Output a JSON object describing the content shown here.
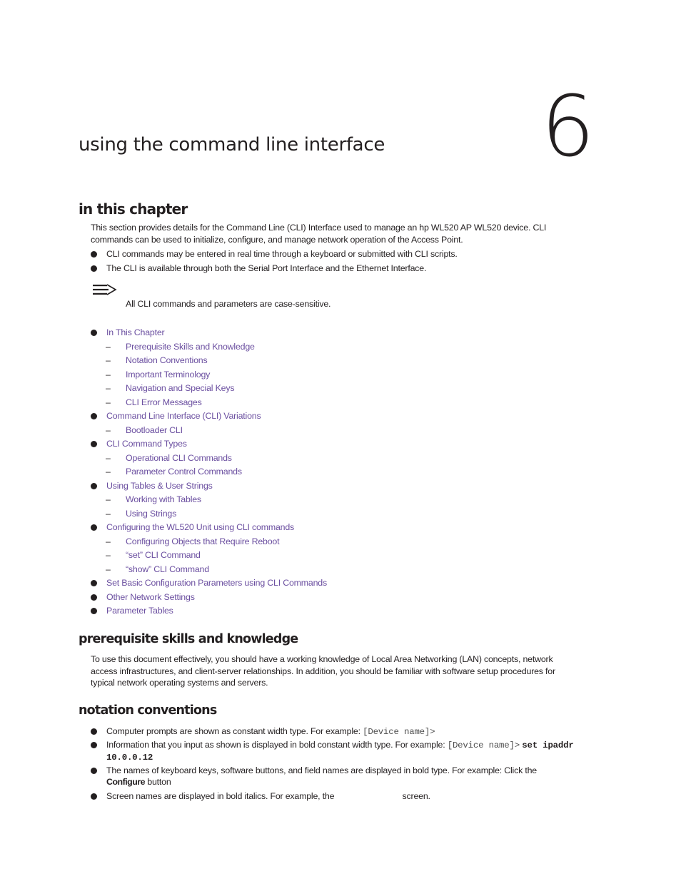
{
  "chapter": {
    "number": "6",
    "title": "using the command line interface"
  },
  "in_this_chapter": {
    "heading": "in this chapter",
    "intro": "This section provides details for the Command Line (CLI) Interface used to manage an hp WL520 AP WL520 device. CLI commands can be used to initialize, configure, and manage network operation of the Access Point.",
    "bullets": [
      "CLI commands may be entered in real time through a keyboard or submitted with CLI scripts.",
      "The CLI is available through both the Serial Port Interface and the Ethernet Interface."
    ],
    "note": {
      "icon": "note-arrow-icon",
      "text": "All CLI commands and parameters are case-sensitive."
    },
    "toc": [
      {
        "label": "In This Chapter",
        "children": [
          "Prerequisite Skills and Knowledge",
          "Notation Conventions",
          "Important Terminology",
          "Navigation and Special Keys",
          "CLI Error Messages"
        ]
      },
      {
        "label": "Command Line Interface (CLI) Variations",
        "children": [
          "Bootloader CLI"
        ]
      },
      {
        "label": "CLI Command Types",
        "children": [
          "Operational CLI Commands",
          "Parameter Control Commands"
        ]
      },
      {
        "label": "Using Tables & User Strings",
        "children": [
          "Working with Tables",
          "Using Strings"
        ]
      },
      {
        "label": "Configuring the WL520 Unit using CLI commands",
        "children": [
          "Configuring Objects that Require Reboot",
          "“set” CLI Command",
          "“show” CLI Command"
        ]
      },
      {
        "label": "Set Basic Configuration Parameters using CLI Commands",
        "children": []
      },
      {
        "label": "Other Network Settings",
        "children": []
      },
      {
        "label": "Parameter Tables",
        "children": []
      }
    ]
  },
  "prerequisite": {
    "heading": "prerequisite skills and knowledge",
    "text": "To use this document effectively, you should have a working knowledge of Local Area Networking (LAN) concepts, network access infrastructures, and client-server relationships. In addition, you should be familiar with software setup procedures for typical network operating systems and servers."
  },
  "notation": {
    "heading": "notation conventions",
    "items": [
      {
        "text": "Computer prompts are shown as constant width type. For example: ",
        "code": "[Device name]>"
      },
      {
        "text": "Information that you input as shown is displayed in bold constant width type. For example: ",
        "code": "[Device name]>",
        "bold_code": "set ipaddr 10.0.0.12"
      },
      {
        "text": "The names of keyboard keys, software buttons, and field names are displayed in bold type. For example: Click the ",
        "bold": "Configure",
        "after": " button"
      },
      {
        "text": "Screen names are displayed in bold italics. For example, the ",
        "gap": "",
        "after": "screen."
      }
    ]
  },
  "colors": {
    "link": "#6b4fa0",
    "text": "#231f20"
  }
}
